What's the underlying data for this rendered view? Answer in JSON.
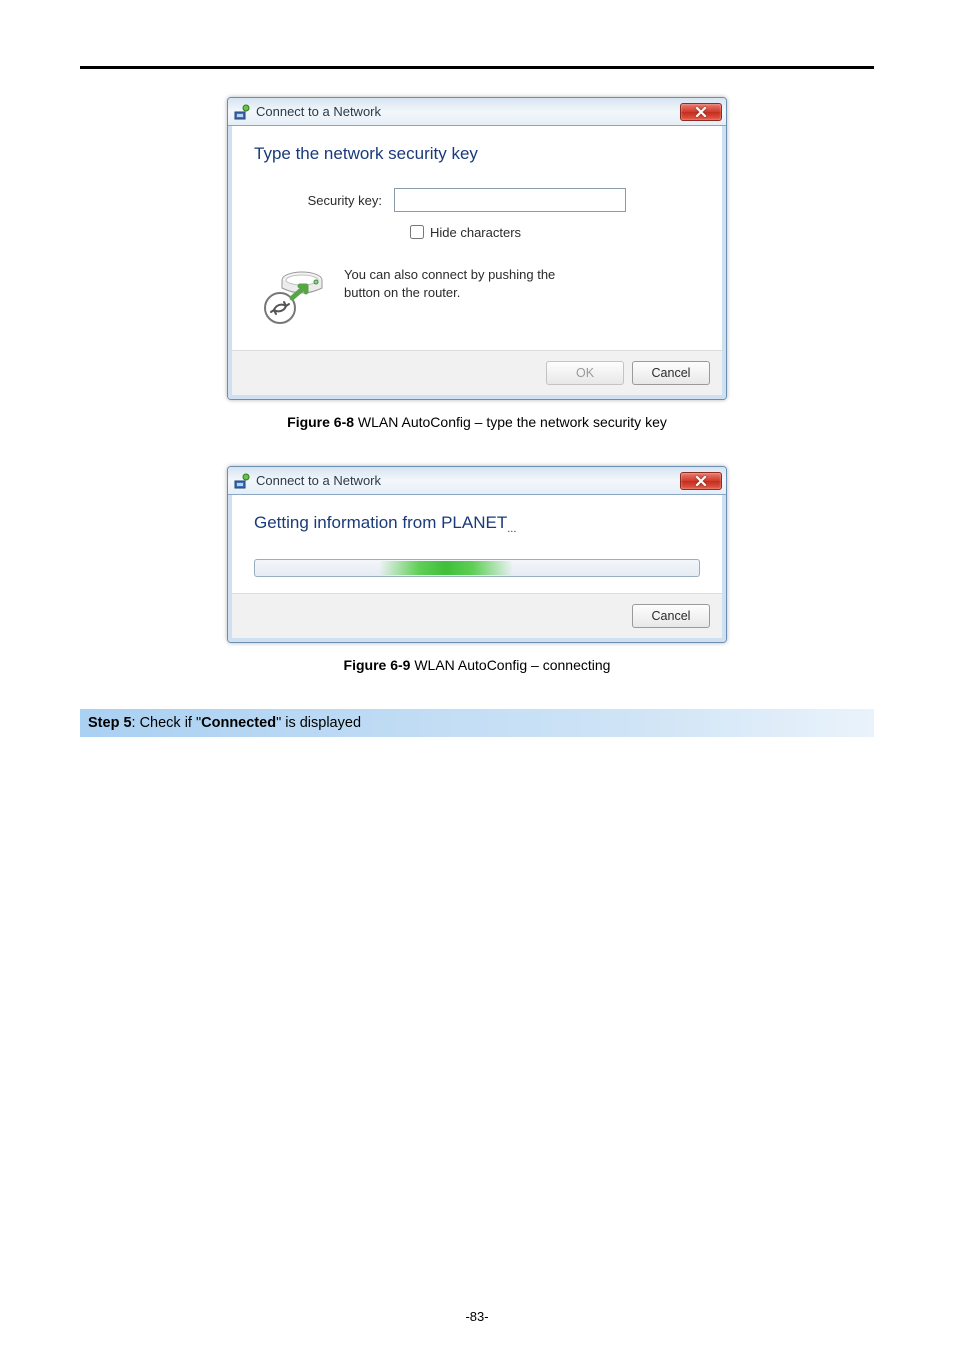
{
  "dialog1": {
    "title": "Connect to a Network",
    "heading": "Type the network security key",
    "securityKeyLabel": "Security key:",
    "securityKeyValue": "",
    "hideCharsLabel": "Hide characters",
    "infoText": "You can also connect by pushing the button on the router.",
    "okLabel": "OK",
    "cancelLabel": "Cancel"
  },
  "caption1": {
    "bold": "Figure 6-8",
    "text": " WLAN AutoConfig – type the network security key"
  },
  "dialog2": {
    "title": "Connect to a Network",
    "heading": "Getting information from PLANET",
    "ellipsis": "...",
    "cancelLabel": "Cancel"
  },
  "caption2": {
    "bold": "Figure 6-9",
    "text": " WLAN AutoConfig – connecting"
  },
  "step": {
    "bold1": "Step 5",
    "mid1": ": Check if \"",
    "bold2": "Connected",
    "mid2": "\" is displayed"
  },
  "pageNumber": "-83-"
}
